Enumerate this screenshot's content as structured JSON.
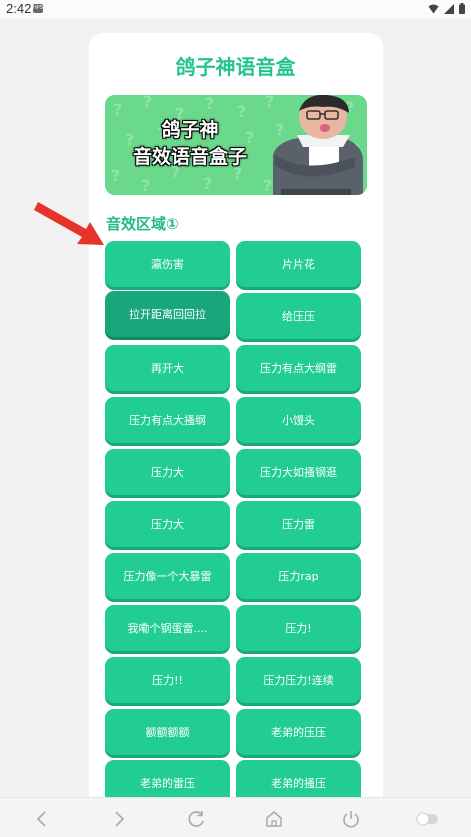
{
  "status": {
    "time": "2:42",
    "app_badge": "HPS"
  },
  "app": {
    "title": "鸽子神语音盒"
  },
  "banner": {
    "line1": "鸽子神",
    "line2": "音效语音盒子"
  },
  "section": {
    "title": "音效区域①"
  },
  "sounds": [
    "瀛伤害",
    "片片花",
    "拉开距离回回拉",
    "给压压",
    "再开大",
    "压力有点大纲雷",
    "压力有点大搔纲",
    "小馒头",
    "压力大",
    "压力大如搔钢逛",
    "压力大",
    "压力雷",
    "压力像一个大暴雷",
    "压力rap",
    "我嘞个钢蛋雷....",
    "压力!",
    "压力!!",
    "压力压力!连续",
    "额额额额",
    "老弟的压压",
    "老弟的雷压",
    "老弟的搔压"
  ],
  "nav": {
    "icons": [
      "back-icon",
      "forward-icon",
      "refresh-icon",
      "home-icon",
      "power-icon",
      "toggle-icon"
    ]
  },
  "colors": {
    "accent": "#22cc95",
    "pressed": "#18a77a",
    "title": "#24c48f",
    "arrow": "#e8332a"
  }
}
